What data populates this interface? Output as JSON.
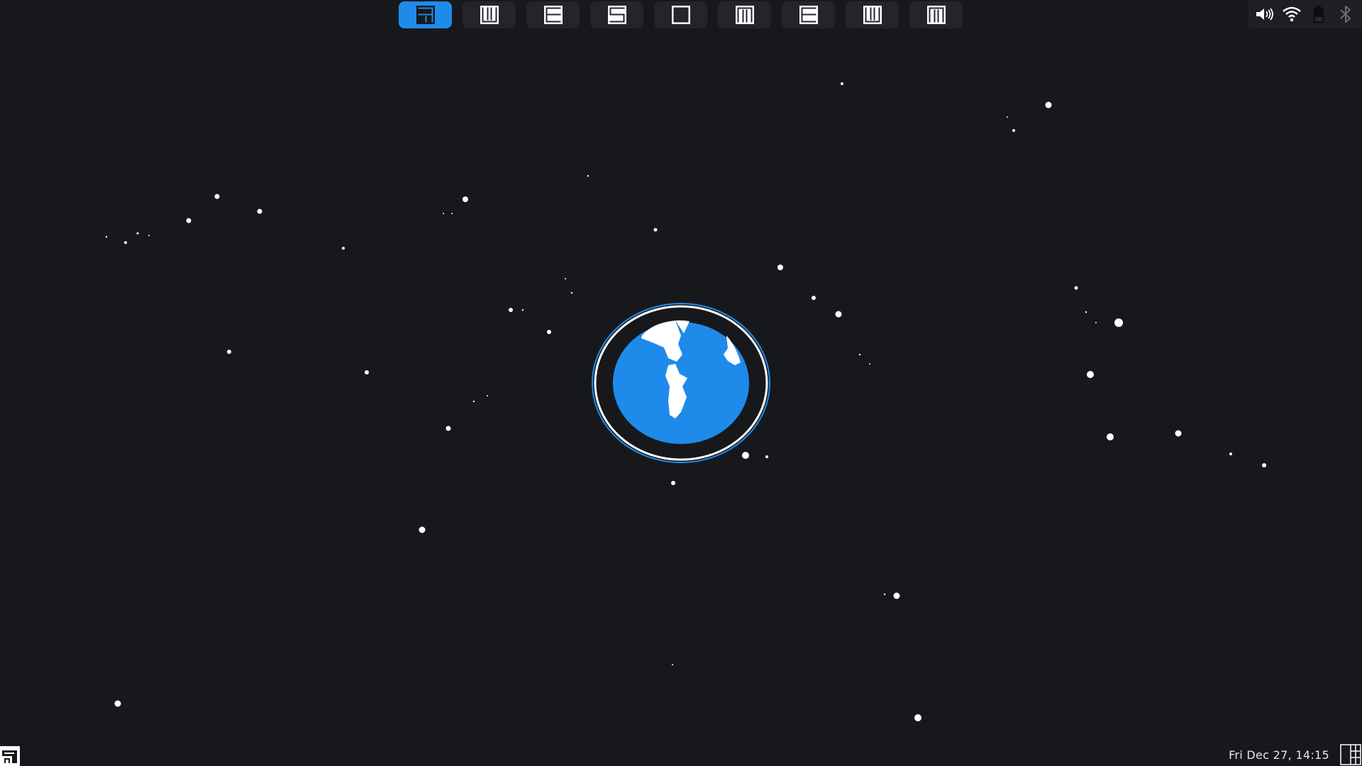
{
  "tags": [
    {
      "name": "tag-1",
      "glyph": "awesome-a",
      "active": true
    },
    {
      "name": "tag-2",
      "glyph": "awesome-w",
      "active": false
    },
    {
      "name": "tag-3",
      "glyph": "awesome-e",
      "active": false
    },
    {
      "name": "tag-4",
      "glyph": "awesome-s",
      "active": false
    },
    {
      "name": "tag-5",
      "glyph": "awesome-o",
      "active": false
    },
    {
      "name": "tag-6",
      "glyph": "awesome-m",
      "active": false
    },
    {
      "name": "tag-7",
      "glyph": "awesome-e",
      "active": false
    },
    {
      "name": "tag-8",
      "glyph": "awesome-w",
      "active": false
    },
    {
      "name": "tag-9",
      "glyph": "awesome-m",
      "active": false
    }
  ],
  "systray": {
    "icons": [
      "volume-icon",
      "wifi-icon",
      "battery-icon",
      "bluetooth-icon"
    ]
  },
  "clock": {
    "text": "Fri Dec 27, 14:15"
  },
  "wallpaper": {
    "logo": "globe-icon",
    "colors": {
      "background": "#17181c",
      "accent": "#1e8bea",
      "star": "#ffffff"
    }
  },
  "launcher": {
    "icon": "awesome-logo-icon"
  },
  "layout": {
    "icon": "tile-layout-icon"
  }
}
